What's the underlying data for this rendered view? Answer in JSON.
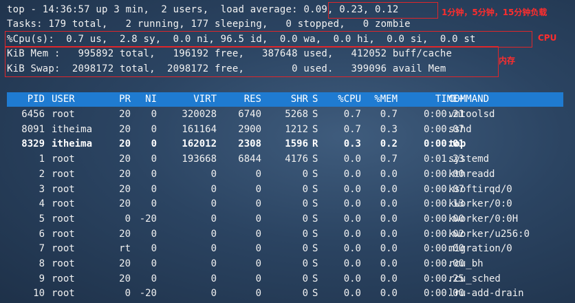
{
  "summary": {
    "line1_prefix": "top - 14:36:57 up 3 min,  2 users,  load average: ",
    "load_average": "0.09, 0.23, 0.12",
    "line2": "Tasks: 179 total,   2 running, 177 sleeping,   0 stopped,   0 zombie",
    "line3": "%Cpu(s):  0.7 us,  2.8 sy,  0.0 ni, 96.5 id,  0.0 wa,  0.0 hi,  0.0 si,  0.0 st",
    "line4": "KiB Mem :   995892 total,   196192 free,   387648 used,   412052 buff/cache",
    "line5": "KiB Swap:  2098172 total,  2098172 free,        0 used.   399096 avail Mem"
  },
  "annotations": {
    "load_average": "1分钟，5分钟，15分钟负载",
    "cpu": "CPU",
    "memory": "内存"
  },
  "columns": [
    "PID",
    "USER",
    "PR",
    "NI",
    "VIRT",
    "RES",
    "SHR",
    "S",
    "%CPU",
    "%MEM",
    "TIME+",
    "COMMAND"
  ],
  "processes": [
    {
      "pid": "6456",
      "user": "root",
      "pr": "20",
      "ni": "0",
      "virt": "320028",
      "res": "6740",
      "shr": "5268",
      "s": "S",
      "cpu": "0.7",
      "mem": "0.7",
      "time": "0:00.21",
      "cmd": "vmtoolsd"
    },
    {
      "pid": "8091",
      "user": "itheima",
      "pr": "20",
      "ni": "0",
      "virt": "161164",
      "res": "2900",
      "shr": "1212",
      "s": "S",
      "cpu": "0.7",
      "mem": "0.3",
      "time": "0:00.07",
      "cmd": "sshd"
    },
    {
      "pid": "8329",
      "user": "itheima",
      "pr": "20",
      "ni": "0",
      "virt": "162012",
      "res": "2308",
      "shr": "1596",
      "s": "R",
      "cpu": "0.3",
      "mem": "0.2",
      "time": "0:00.01",
      "cmd": "top"
    },
    {
      "pid": "1",
      "user": "root",
      "pr": "20",
      "ni": "0",
      "virt": "193668",
      "res": "6844",
      "shr": "4176",
      "s": "S",
      "cpu": "0.0",
      "mem": "0.7",
      "time": "0:01.23",
      "cmd": "systemd"
    },
    {
      "pid": "2",
      "user": "root",
      "pr": "20",
      "ni": "0",
      "virt": "0",
      "res": "0",
      "shr": "0",
      "s": "S",
      "cpu": "0.0",
      "mem": "0.0",
      "time": "0:00.00",
      "cmd": "kthreadd"
    },
    {
      "pid": "3",
      "user": "root",
      "pr": "20",
      "ni": "0",
      "virt": "0",
      "res": "0",
      "shr": "0",
      "s": "S",
      "cpu": "0.0",
      "mem": "0.0",
      "time": "0:00.07",
      "cmd": "ksoftirqd/0"
    },
    {
      "pid": "4",
      "user": "root",
      "pr": "20",
      "ni": "0",
      "virt": "0",
      "res": "0",
      "shr": "0",
      "s": "S",
      "cpu": "0.0",
      "mem": "0.0",
      "time": "0:00.13",
      "cmd": "kworker/0:0"
    },
    {
      "pid": "5",
      "user": "root",
      "pr": "0",
      "ni": "-20",
      "virt": "0",
      "res": "0",
      "shr": "0",
      "s": "S",
      "cpu": "0.0",
      "mem": "0.0",
      "time": "0:00.00",
      "cmd": "kworker/0:0H"
    },
    {
      "pid": "6",
      "user": "root",
      "pr": "20",
      "ni": "0",
      "virt": "0",
      "res": "0",
      "shr": "0",
      "s": "S",
      "cpu": "0.0",
      "mem": "0.0",
      "time": "0:00.02",
      "cmd": "kworker/u256:0"
    },
    {
      "pid": "7",
      "user": "root",
      "pr": "rt",
      "ni": "0",
      "virt": "0",
      "res": "0",
      "shr": "0",
      "s": "S",
      "cpu": "0.0",
      "mem": "0.0",
      "time": "0:00.00",
      "cmd": "migration/0"
    },
    {
      "pid": "8",
      "user": "root",
      "pr": "20",
      "ni": "0",
      "virt": "0",
      "res": "0",
      "shr": "0",
      "s": "S",
      "cpu": "0.0",
      "mem": "0.0",
      "time": "0:00.00",
      "cmd": "rcu_bh"
    },
    {
      "pid": "9",
      "user": "root",
      "pr": "20",
      "ni": "0",
      "virt": "0",
      "res": "0",
      "shr": "0",
      "s": "S",
      "cpu": "0.0",
      "mem": "0.0",
      "time": "0:00.25",
      "cmd": "rcu_sched"
    },
    {
      "pid": "10",
      "user": "root",
      "pr": "0",
      "ni": "-20",
      "virt": "0",
      "res": "0",
      "shr": "0",
      "s": "S",
      "cpu": "0.0",
      "mem": "0.0",
      "time": "0:00.00",
      "cmd": "lru-add-drain"
    }
  ],
  "colors": {
    "background": "#2b4462",
    "header_bar": "#1f7bd1",
    "highlight_box": "#e0262a",
    "annotation_text": "#ff2d2d"
  }
}
